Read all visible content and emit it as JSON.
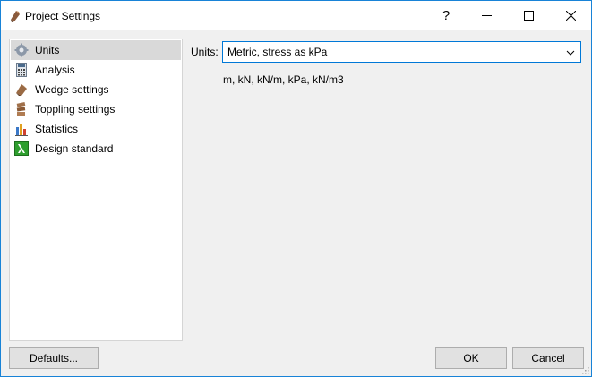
{
  "window": {
    "title": "Project Settings",
    "help_glyph": "?",
    "title_icon": "wedge-app-icon"
  },
  "sidebar": {
    "items": [
      {
        "label": "Units",
        "icon": "gear-icon",
        "selected": true
      },
      {
        "label": "Analysis",
        "icon": "calculator-icon",
        "selected": false
      },
      {
        "label": "Wedge settings",
        "icon": "wedge-icon",
        "selected": false
      },
      {
        "label": "Toppling settings",
        "icon": "toppling-icon",
        "selected": false
      },
      {
        "label": "Statistics",
        "icon": "bar-chart-icon",
        "selected": false
      },
      {
        "label": "Design standard",
        "icon": "lambda-icon",
        "selected": false
      }
    ]
  },
  "main": {
    "units_label": "Units:",
    "units_value": "Metric, stress as kPa",
    "units_description": "m, kN, kN/m, kPa, kN/m3"
  },
  "footer": {
    "defaults_label": "Defaults...",
    "ok_label": "OK",
    "cancel_label": "Cancel"
  },
  "colors": {
    "accent": "#0078d7",
    "selection": "#d9d9d9",
    "lambda_green": "#2e9e2e"
  }
}
